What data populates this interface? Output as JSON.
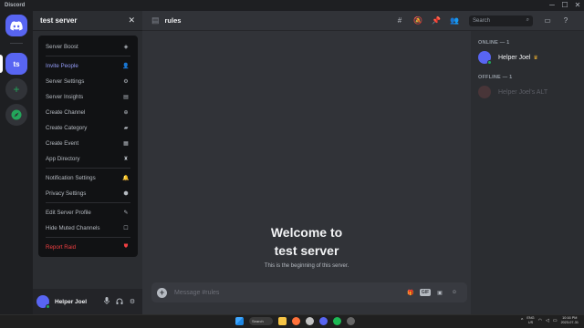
{
  "window": {
    "app_title": "Discord",
    "minimize": "─",
    "maximize": "☐",
    "close": "✕"
  },
  "rail": {
    "server_initials": "ts"
  },
  "sidebar": {
    "server_name": "test server",
    "close": "✕",
    "user": {
      "name": "Helper Joel"
    }
  },
  "server_menu": {
    "items": [
      {
        "label": "Server Boost",
        "icon": "boost-icon"
      },
      {
        "label": "Invite People",
        "icon": "add-person-icon"
      },
      {
        "label": "Server Settings",
        "icon": "gear-icon"
      },
      {
        "label": "Server Insights",
        "icon": "insights-icon"
      },
      {
        "label": "Create Channel",
        "icon": "plus-circle-icon"
      },
      {
        "label": "Create Category",
        "icon": "folder-plus-icon"
      },
      {
        "label": "Create Event",
        "icon": "calendar-plus-icon"
      },
      {
        "label": "App Directory",
        "icon": "robot-icon"
      },
      {
        "label": "Notification Settings",
        "icon": "bell-icon"
      },
      {
        "label": "Privacy Settings",
        "icon": "shield-icon"
      },
      {
        "label": "Edit Server Profile",
        "icon": "pencil-icon"
      },
      {
        "label": "Hide Muted Channels",
        "icon": "checkbox-icon"
      },
      {
        "label": "Report Raid",
        "icon": "shield-alert-icon"
      }
    ]
  },
  "channel": {
    "name": "rules"
  },
  "search": {
    "placeholder": "Search"
  },
  "welcome": {
    "line1": "Welcome to",
    "line2": "test server",
    "subtitle": "This is the beginning of this server."
  },
  "composer": {
    "placeholder": "Message #rules",
    "gif": "GIF"
  },
  "members": {
    "online_header": "ONLINE — 1",
    "offline_header": "OFFLINE — 1",
    "online": [
      {
        "name": "Helper Joel"
      }
    ],
    "offline": [
      {
        "name": "Helper Joel's ALT"
      }
    ]
  },
  "taskbar": {
    "search_label": "Search",
    "lang_line1": "ENG",
    "lang_line2": "US",
    "time": "10:16 PM",
    "date": "2023-07-31"
  },
  "colors": {
    "blurple": "#5865f2",
    "green": "#23a55a",
    "danger": "#f23f42",
    "accent": "#949cf7",
    "crown": "#f0b232"
  }
}
